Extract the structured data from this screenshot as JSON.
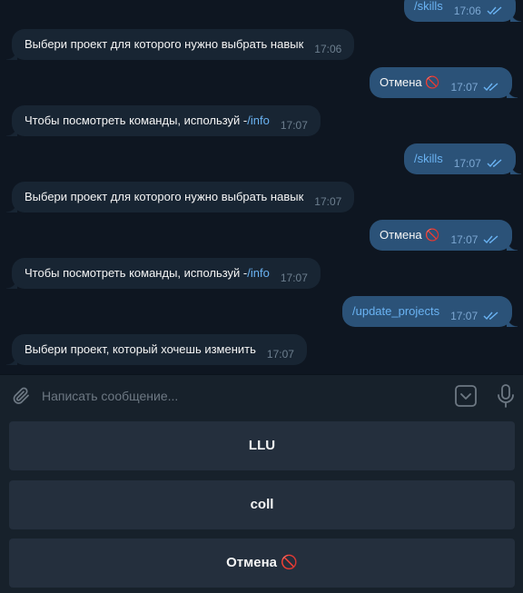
{
  "messages": [
    {
      "dir": "out",
      "text": "/skills",
      "link": true,
      "time": "17:06",
      "read": true
    },
    {
      "dir": "in",
      "text": "Выбери проект для которого нужно выбрать навык",
      "time": "17:06"
    },
    {
      "dir": "out",
      "text": "Отмена 🚫",
      "time": "17:07",
      "read": true
    },
    {
      "dir": "in",
      "text": "Чтобы посмотреть команды, используй - ",
      "link_text": "/info",
      "time": "17:07"
    },
    {
      "dir": "out",
      "text": "/skills",
      "link": true,
      "time": "17:07",
      "read": true
    },
    {
      "dir": "in",
      "text": "Выбери проект для которого нужно выбрать навык",
      "time": "17:07"
    },
    {
      "dir": "out",
      "text": "Отмена 🚫",
      "time": "17:07",
      "read": true
    },
    {
      "dir": "in",
      "text": "Чтобы посмотреть команды, используй - ",
      "link_text": "/info",
      "time": "17:07"
    },
    {
      "dir": "out",
      "text": "/update_projects",
      "link": true,
      "time": "17:07",
      "read": true
    },
    {
      "dir": "in",
      "text": "Выбери проект, который хочешь изменить",
      "time": "17:07"
    }
  ],
  "composer": {
    "placeholder": "Написать сообщение...",
    "attach_icon": "paperclip-icon",
    "keyboard_icon": "keyboard-toggle-icon",
    "mic_icon": "microphone-icon"
  },
  "reply_keyboard": {
    "buttons": [
      "LLU",
      "coll",
      "Отмена 🚫"
    ]
  },
  "colors": {
    "background": "#0e1621",
    "incoming_bubble": "#182533",
    "outgoing_bubble": "#2b5278",
    "link": "#6ab3f3",
    "keyboard_button": "#242f3d",
    "panel": "#17212b"
  }
}
